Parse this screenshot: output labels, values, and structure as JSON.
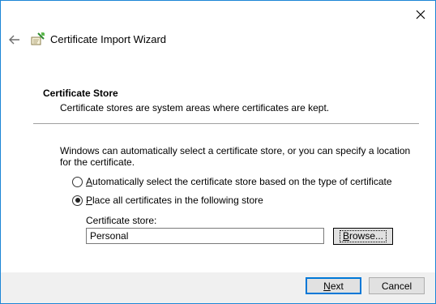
{
  "window": {
    "title": "Certificate Import Wizard",
    "accent_color": "#1c86d6"
  },
  "header": {
    "back_icon": "arrow-left-icon",
    "wizard_icon": "certificate-wizard-icon",
    "close_icon": "close-icon"
  },
  "section": {
    "title": "Certificate Store",
    "description": "Certificate stores are system areas where certificates are kept."
  },
  "body": {
    "intro": "Windows can automatically select a certificate store, or you can specify a location for the certificate."
  },
  "options": [
    {
      "label_access_key": "A",
      "label_rest": "utomatically select the certificate store based on the type of certificate",
      "checked": false
    },
    {
      "label_access_key": "P",
      "label_rest": "lace all certificates in the following store",
      "checked": true
    }
  ],
  "store": {
    "label": "Certificate store:",
    "value": "Personal",
    "browse_access_key": "B",
    "browse_rest": "rowse..."
  },
  "footer": {
    "next_access_key": "N",
    "next_rest": "ext",
    "cancel_label": "Cancel"
  }
}
